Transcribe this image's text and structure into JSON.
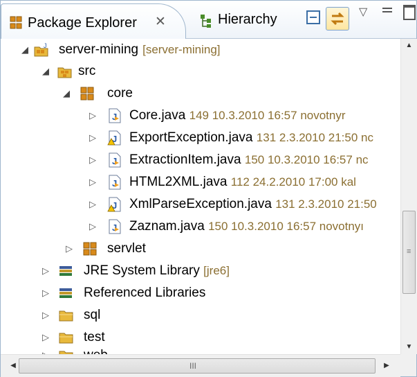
{
  "tabs": {
    "active_label": "Package Explorer",
    "active_close": "✕",
    "second_label": "Hierarchy"
  },
  "toolbar": {
    "collapse_all_icon": "collapse-all-icon",
    "link_with_editor_icon": "link-with-editor-icon",
    "view_menu_icon": "view-menu-icon",
    "minimize_icon": "minimize-icon",
    "maximize_icon": "maximize-icon"
  },
  "tree": {
    "project": {
      "name": "server-mining",
      "decoration": "[server-mining]"
    },
    "src": "src",
    "core": "core",
    "files": [
      {
        "name": "Core.java",
        "decoration": "149  10.3.2010 16:57  novotnyr"
      },
      {
        "name": "ExportException.java",
        "decoration": "131  2.3.2010 21:50  nc"
      },
      {
        "name": "ExtractionItem.java",
        "decoration": "150  10.3.2010 16:57  nc"
      },
      {
        "name": "HTML2XML.java",
        "decoration": "112  24.2.2010 17:00  kal"
      },
      {
        "name": "XmlParseException.java",
        "decoration": "131  2.3.2010 21:50"
      },
      {
        "name": "Zaznam.java",
        "decoration": "150  10.3.2010 16:57  novotnyı"
      }
    ],
    "servlet": "servlet",
    "jre": {
      "name": "JRE System Library",
      "decoration": "[jre6]"
    },
    "ref_libs": "Referenced Libraries",
    "sql": "sql",
    "test": "test",
    "web": "web"
  },
  "scroll": {
    "up": "▲",
    "down": "▼",
    "left": "◀",
    "right": "▶",
    "vgrip": "≡",
    "hgrip": "III"
  },
  "colors": {
    "decoration": "#8b6f32",
    "frame_border": "#9fb6cd",
    "package_orange": "#d98a1a",
    "folder_yellow": "#e8b93c"
  }
}
